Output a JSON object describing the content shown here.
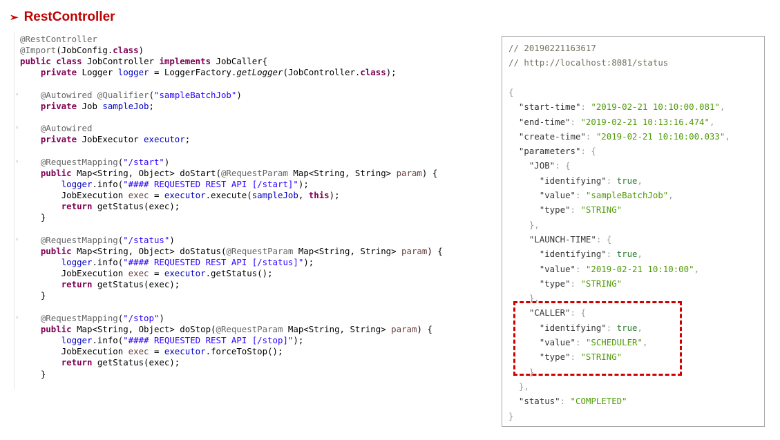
{
  "heading": {
    "arrow": "➢",
    "title": "RestController"
  },
  "code": {
    "lines": [
      [
        {
          "t": "@RestController",
          "c": "ann"
        }
      ],
      [
        {
          "t": "@Import",
          "c": "ann"
        },
        {
          "t": "(JobConfig.",
          "c": ""
        },
        {
          "t": "class",
          "c": "kw"
        },
        {
          "t": ")",
          "c": ""
        }
      ],
      [
        {
          "t": "public",
          "c": "kw"
        },
        {
          "t": " ",
          "c": ""
        },
        {
          "t": "class",
          "c": "kw"
        },
        {
          "t": " JobController ",
          "c": ""
        },
        {
          "t": "implements",
          "c": "kw"
        },
        {
          "t": " JobCaller{",
          "c": ""
        }
      ],
      [
        {
          "t": "    ",
          "c": ""
        },
        {
          "t": "private",
          "c": "kw"
        },
        {
          "t": " Logger ",
          "c": ""
        },
        {
          "t": "logger",
          "c": "field"
        },
        {
          "t": " = LoggerFactory.",
          "c": ""
        },
        {
          "t": "getLogger",
          "c": "static"
        },
        {
          "t": "(JobController.",
          "c": ""
        },
        {
          "t": "class",
          "c": "kw"
        },
        {
          "t": ");",
          "c": ""
        }
      ],
      [],
      [
        {
          "t": "    ",
          "c": ""
        },
        {
          "t": "@Autowired",
          "c": "ann"
        },
        {
          "t": " ",
          "c": ""
        },
        {
          "t": "@Qualifier",
          "c": "ann"
        },
        {
          "t": "(",
          "c": ""
        },
        {
          "t": "\"sampleBatchJob\"",
          "c": "str"
        },
        {
          "t": ")",
          "c": ""
        }
      ],
      [
        {
          "t": "    ",
          "c": ""
        },
        {
          "t": "private",
          "c": "kw"
        },
        {
          "t": " Job ",
          "c": ""
        },
        {
          "t": "sampleJob",
          "c": "field"
        },
        {
          "t": ";",
          "c": ""
        }
      ],
      [],
      [
        {
          "t": "    ",
          "c": ""
        },
        {
          "t": "@Autowired",
          "c": "ann"
        }
      ],
      [
        {
          "t": "    ",
          "c": ""
        },
        {
          "t": "private",
          "c": "kw"
        },
        {
          "t": " JobExecutor ",
          "c": ""
        },
        {
          "t": "executor",
          "c": "field"
        },
        {
          "t": ";",
          "c": ""
        }
      ],
      [],
      [
        {
          "t": "    ",
          "c": ""
        },
        {
          "t": "@RequestMapping",
          "c": "ann"
        },
        {
          "t": "(",
          "c": ""
        },
        {
          "t": "\"/start\"",
          "c": "str"
        },
        {
          "t": ")",
          "c": ""
        }
      ],
      [
        {
          "t": "    ",
          "c": ""
        },
        {
          "t": "public",
          "c": "kw"
        },
        {
          "t": " Map<String, Object> doStart(",
          "c": ""
        },
        {
          "t": "@RequestParam",
          "c": "ann"
        },
        {
          "t": " Map<String, String> ",
          "c": ""
        },
        {
          "t": "param",
          "c": "param"
        },
        {
          "t": ") {",
          "c": ""
        }
      ],
      [
        {
          "t": "        ",
          "c": ""
        },
        {
          "t": "logger",
          "c": "field"
        },
        {
          "t": ".info(",
          "c": ""
        },
        {
          "t": "\"#### REQUESTED REST API [/start]\"",
          "c": "str"
        },
        {
          "t": ");",
          "c": ""
        }
      ],
      [
        {
          "t": "        JobExecution ",
          "c": ""
        },
        {
          "t": "exec",
          "c": "param"
        },
        {
          "t": " = ",
          "c": ""
        },
        {
          "t": "executor",
          "c": "field"
        },
        {
          "t": ".execute(",
          "c": ""
        },
        {
          "t": "sampleJob",
          "c": "field"
        },
        {
          "t": ", ",
          "c": ""
        },
        {
          "t": "this",
          "c": "kw"
        },
        {
          "t": ");",
          "c": ""
        }
      ],
      [
        {
          "t": "        ",
          "c": ""
        },
        {
          "t": "return",
          "c": "kw"
        },
        {
          "t": " getStatus(exec);",
          "c": ""
        }
      ],
      [
        {
          "t": "    }",
          "c": ""
        }
      ],
      [],
      [
        {
          "t": "    ",
          "c": ""
        },
        {
          "t": "@RequestMapping",
          "c": "ann"
        },
        {
          "t": "(",
          "c": ""
        },
        {
          "t": "\"/status\"",
          "c": "str"
        },
        {
          "t": ")",
          "c": ""
        }
      ],
      [
        {
          "t": "    ",
          "c": ""
        },
        {
          "t": "public",
          "c": "kw"
        },
        {
          "t": " Map<String, Object> doStatus(",
          "c": ""
        },
        {
          "t": "@RequestParam",
          "c": "ann"
        },
        {
          "t": " Map<String, String> ",
          "c": ""
        },
        {
          "t": "param",
          "c": "param"
        },
        {
          "t": ") {",
          "c": ""
        }
      ],
      [
        {
          "t": "        ",
          "c": ""
        },
        {
          "t": "logger",
          "c": "field"
        },
        {
          "t": ".info(",
          "c": ""
        },
        {
          "t": "\"#### REQUESTED REST API [/status]\"",
          "c": "str"
        },
        {
          "t": ");",
          "c": ""
        }
      ],
      [
        {
          "t": "        JobExecution ",
          "c": ""
        },
        {
          "t": "exec",
          "c": "param"
        },
        {
          "t": " = ",
          "c": ""
        },
        {
          "t": "executor",
          "c": "field"
        },
        {
          "t": ".getStatus();",
          "c": ""
        }
      ],
      [
        {
          "t": "        ",
          "c": ""
        },
        {
          "t": "return",
          "c": "kw"
        },
        {
          "t": " getStatus(exec);",
          "c": ""
        }
      ],
      [
        {
          "t": "    }",
          "c": ""
        }
      ],
      [],
      [
        {
          "t": "    ",
          "c": ""
        },
        {
          "t": "@RequestMapping",
          "c": "ann"
        },
        {
          "t": "(",
          "c": ""
        },
        {
          "t": "\"/stop\"",
          "c": "str"
        },
        {
          "t": ")",
          "c": ""
        }
      ],
      [
        {
          "t": "    ",
          "c": ""
        },
        {
          "t": "public",
          "c": "kw"
        },
        {
          "t": " Map<String, Object> doStop(",
          "c": ""
        },
        {
          "t": "@RequestParam",
          "c": "ann"
        },
        {
          "t": " Map<String, String> ",
          "c": ""
        },
        {
          "t": "param",
          "c": "param"
        },
        {
          "t": ") {",
          "c": ""
        }
      ],
      [
        {
          "t": "        ",
          "c": ""
        },
        {
          "t": "logger",
          "c": "field"
        },
        {
          "t": ".info(",
          "c": ""
        },
        {
          "t": "\"#### REQUESTED REST API [/stop]\"",
          "c": "str"
        },
        {
          "t": ");",
          "c": ""
        }
      ],
      [
        {
          "t": "        JobExecution ",
          "c": ""
        },
        {
          "t": "exec",
          "c": "param"
        },
        {
          "t": " = ",
          "c": ""
        },
        {
          "t": "executor",
          "c": "field"
        },
        {
          "t": ".forceToStop();",
          "c": ""
        }
      ],
      [
        {
          "t": "        ",
          "c": ""
        },
        {
          "t": "return",
          "c": "kw"
        },
        {
          "t": " getStatus(exec);",
          "c": ""
        }
      ],
      [
        {
          "t": "    }",
          "c": ""
        }
      ]
    ],
    "fold_marker": "◦"
  },
  "json_view": {
    "lines": [
      [
        {
          "t": "// 20190221163617",
          "c": "comment"
        }
      ],
      [
        {
          "t": "// http://localhost:8081/status",
          "c": "comment"
        }
      ],
      [],
      [
        {
          "t": "{",
          "c": "punc"
        }
      ],
      [
        {
          "t": "  ",
          "c": ""
        },
        {
          "t": "\"start-time\"",
          "c": "key"
        },
        {
          "t": ": ",
          "c": "punc"
        },
        {
          "t": "\"2019-02-21 10:10:00.081\"",
          "c": "str"
        },
        {
          "t": ",",
          "c": "punc"
        }
      ],
      [
        {
          "t": "  ",
          "c": ""
        },
        {
          "t": "\"end-time\"",
          "c": "key"
        },
        {
          "t": ": ",
          "c": "punc"
        },
        {
          "t": "\"2019-02-21 10:13:16.474\"",
          "c": "str"
        },
        {
          "t": ",",
          "c": "punc"
        }
      ],
      [
        {
          "t": "  ",
          "c": ""
        },
        {
          "t": "\"create-time\"",
          "c": "key"
        },
        {
          "t": ": ",
          "c": "punc"
        },
        {
          "t": "\"2019-02-21 10:10:00.033\"",
          "c": "str"
        },
        {
          "t": ",",
          "c": "punc"
        }
      ],
      [
        {
          "t": "  ",
          "c": ""
        },
        {
          "t": "\"parameters\"",
          "c": "key"
        },
        {
          "t": ": {",
          "c": "punc"
        }
      ],
      [
        {
          "t": "    ",
          "c": ""
        },
        {
          "t": "\"JOB\"",
          "c": "key"
        },
        {
          "t": ": {",
          "c": "punc"
        }
      ],
      [
        {
          "t": "      ",
          "c": ""
        },
        {
          "t": "\"identifying\"",
          "c": "key"
        },
        {
          "t": ": ",
          "c": "punc"
        },
        {
          "t": "true",
          "c": "bool"
        },
        {
          "t": ",",
          "c": "punc"
        }
      ],
      [
        {
          "t": "      ",
          "c": ""
        },
        {
          "t": "\"value\"",
          "c": "key"
        },
        {
          "t": ": ",
          "c": "punc"
        },
        {
          "t": "\"sampleBatchJob\"",
          "c": "str"
        },
        {
          "t": ",",
          "c": "punc"
        }
      ],
      [
        {
          "t": "      ",
          "c": ""
        },
        {
          "t": "\"type\"",
          "c": "key"
        },
        {
          "t": ": ",
          "c": "punc"
        },
        {
          "t": "\"STRING\"",
          "c": "str"
        }
      ],
      [
        {
          "t": "    },",
          "c": "punc"
        }
      ],
      [
        {
          "t": "    ",
          "c": ""
        },
        {
          "t": "\"LAUNCH-TIME\"",
          "c": "key"
        },
        {
          "t": ": {",
          "c": "punc"
        }
      ],
      [
        {
          "t": "      ",
          "c": ""
        },
        {
          "t": "\"identifying\"",
          "c": "key"
        },
        {
          "t": ": ",
          "c": "punc"
        },
        {
          "t": "true",
          "c": "bool"
        },
        {
          "t": ",",
          "c": "punc"
        }
      ],
      [
        {
          "t": "      ",
          "c": ""
        },
        {
          "t": "\"value\"",
          "c": "key"
        },
        {
          "t": ": ",
          "c": "punc"
        },
        {
          "t": "\"2019-02-21 10:10:00\"",
          "c": "str"
        },
        {
          "t": ",",
          "c": "punc"
        }
      ],
      [
        {
          "t": "      ",
          "c": ""
        },
        {
          "t": "\"type\"",
          "c": "key"
        },
        {
          "t": ": ",
          "c": "punc"
        },
        {
          "t": "\"STRING\"",
          "c": "str"
        }
      ],
      [
        {
          "t": "    },",
          "c": "punc"
        }
      ],
      [
        {
          "t": "    ",
          "c": ""
        },
        {
          "t": "\"CALLER\"",
          "c": "key"
        },
        {
          "t": ": {",
          "c": "punc"
        }
      ],
      [
        {
          "t": "      ",
          "c": ""
        },
        {
          "t": "\"identifying\"",
          "c": "key"
        },
        {
          "t": ": ",
          "c": "punc"
        },
        {
          "t": "true",
          "c": "bool"
        },
        {
          "t": ",",
          "c": "punc"
        }
      ],
      [
        {
          "t": "      ",
          "c": ""
        },
        {
          "t": "\"value\"",
          "c": "key"
        },
        {
          "t": ": ",
          "c": "punc"
        },
        {
          "t": "\"SCHEDULER\"",
          "c": "str"
        },
        {
          "t": ",",
          "c": "punc"
        }
      ],
      [
        {
          "t": "      ",
          "c": ""
        },
        {
          "t": "\"type\"",
          "c": "key"
        },
        {
          "t": ": ",
          "c": "punc"
        },
        {
          "t": "\"STRING\"",
          "c": "str"
        }
      ],
      [
        {
          "t": "    }",
          "c": "punc"
        }
      ],
      [
        {
          "t": "  },",
          "c": "punc"
        }
      ],
      [
        {
          "t": "  ",
          "c": ""
        },
        {
          "t": "\"status\"",
          "c": "key"
        },
        {
          "t": ": ",
          "c": "punc"
        },
        {
          "t": "\"COMPLETED\"",
          "c": "str"
        }
      ],
      [
        {
          "t": "}",
          "c": "punc"
        }
      ]
    ]
  },
  "colors": {
    "heading": "#c00000",
    "highlight_border": "#d00000",
    "keyword": "#7f0055",
    "string": "#2a00ff",
    "json_string": "#4e9a06"
  }
}
